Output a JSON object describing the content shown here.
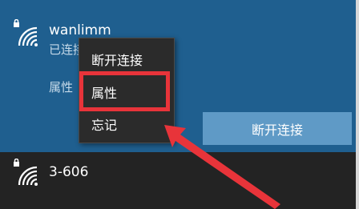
{
  "networks": [
    {
      "name": "wanlimm",
      "status": "已连接，安全",
      "properties_link": "属性",
      "disconnect_label": "断开连接",
      "icon": "wifi-secured-icon"
    },
    {
      "name": "3-606",
      "icon": "wifi-secured-icon"
    }
  ],
  "context_menu": {
    "items": [
      "断开连接",
      "属性",
      "忘记"
    ],
    "highlighted": "属性"
  },
  "colors": {
    "active_bg": "#1f5f8f",
    "button_bg": "#5f9ac6",
    "menu_bg": "#2b2b2b",
    "annotation": "#e8343a"
  }
}
